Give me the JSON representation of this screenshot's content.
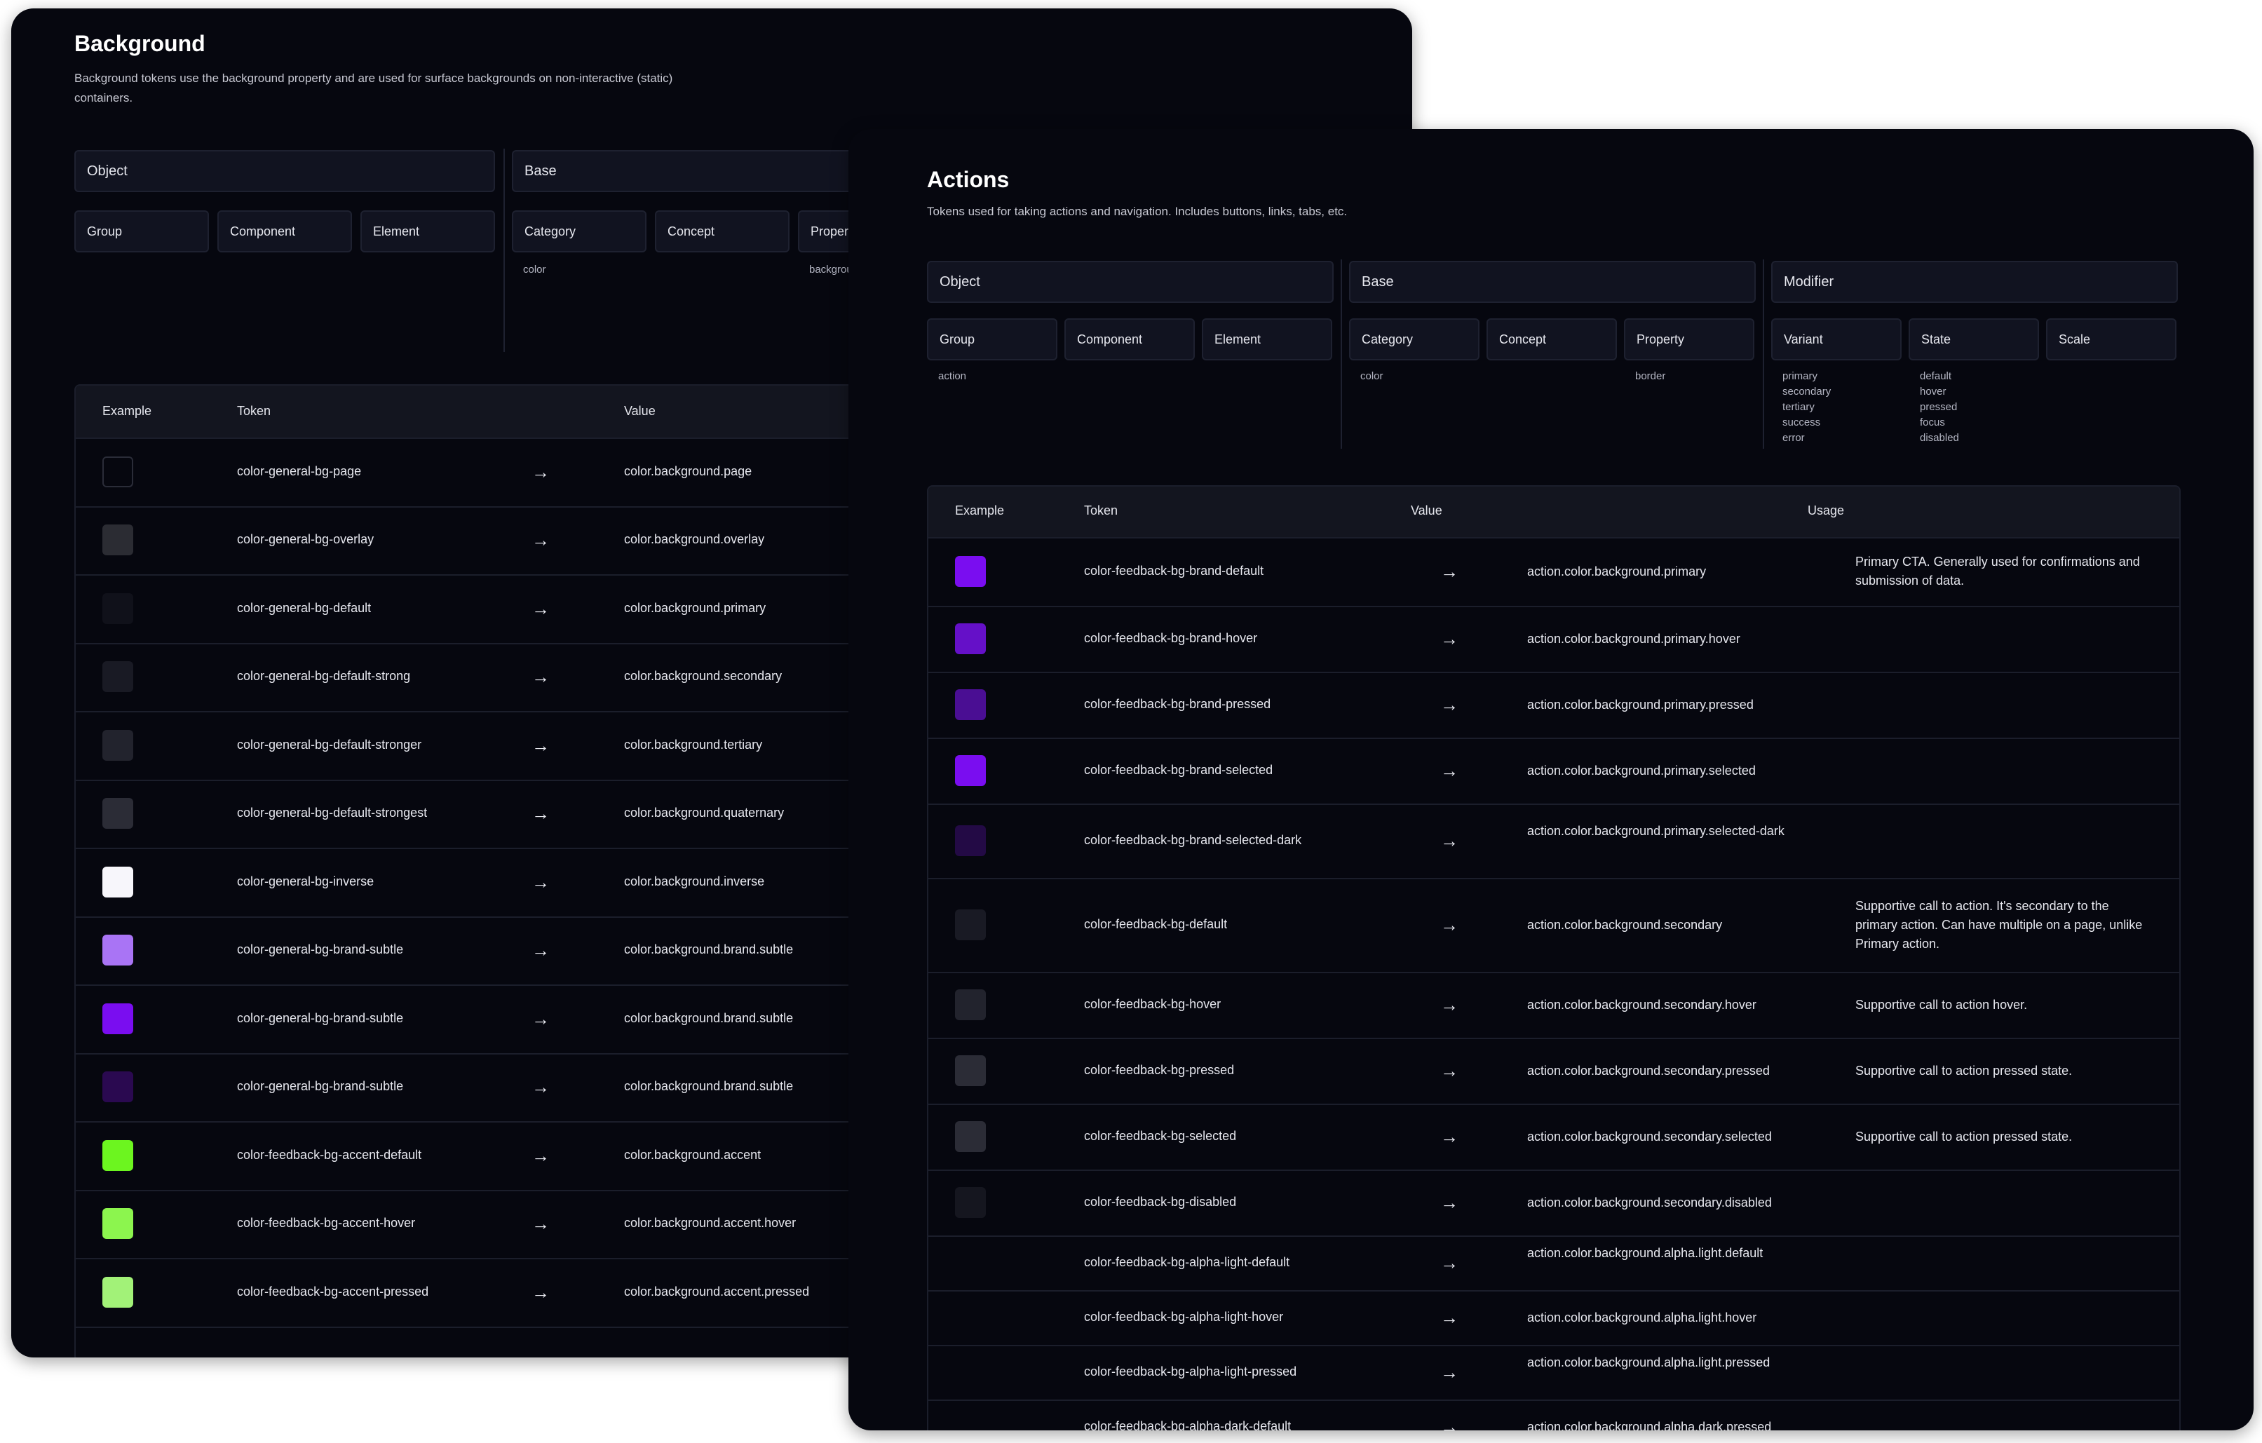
{
  "background_panel": {
    "title": "Background",
    "description": "Background tokens use the background property and are used for surface backgrounds on non-interactive (static) containers.",
    "groups": {
      "object": "Object",
      "base": "Base"
    },
    "columns": {
      "group": "Group",
      "component": "Component",
      "element": "Element",
      "category": "Category",
      "concept": "Concept",
      "property": "Property"
    },
    "values": {
      "category": "color",
      "property": "background"
    },
    "table_headers": {
      "example": "Example",
      "token": "Token",
      "value": "Value"
    },
    "arrow": "→",
    "rows": [
      {
        "token": "color-general-bg-page",
        "value": "color.background.page",
        "swatch": "#06070f"
      },
      {
        "token": "color-general-bg-overlay",
        "value": "color.background.overlay",
        "swatch": "#2b2c33"
      },
      {
        "token": "color-general-bg-default",
        "value": "color.background.primary",
        "swatch": "#10111a"
      },
      {
        "token": "color-general-bg-default-strong",
        "value": "color.background.secondary",
        "swatch": "#191a24"
      },
      {
        "token": "color-general-bg-default-stronger",
        "value": "color.background.tertiary",
        "swatch": "#22232d"
      },
      {
        "token": "color-general-bg-default-strongest",
        "value": "color.background.quaternary",
        "swatch": "#2b2c36"
      },
      {
        "token": "color-general-bg-inverse",
        "value": "color.background.inverse",
        "swatch": "#f7f6fb"
      },
      {
        "token": "color-general-bg-brand-subtle",
        "value": "color.background.brand.subtle",
        "swatch": "#a974f5"
      },
      {
        "token": "color-general-bg-brand-subtle",
        "value": "color.background.brand.subtle",
        "swatch": "#7a0df0"
      },
      {
        "token": "color-general-bg-brand-subtle",
        "value": "color.background.brand.subtle",
        "swatch": "#2a0950"
      },
      {
        "token": "color-feedback-bg-accent-default",
        "value": "color.background.accent",
        "swatch": "#6cf51f"
      },
      {
        "token": "color-feedback-bg-accent-hover",
        "value": "color.background.accent.hover",
        "swatch": "#8cf54e"
      },
      {
        "token": "color-feedback-bg-accent-pressed",
        "value": "color.background.accent.pressed",
        "swatch": "#a2f278"
      }
    ]
  },
  "actions_panel": {
    "title": "Actions",
    "description": "Tokens used for taking actions and navigation. Includes buttons, links, tabs, etc.",
    "groups": {
      "object": "Object",
      "base": "Base",
      "modifier": "Modifier"
    },
    "columns": {
      "group": "Group",
      "component": "Component",
      "element": "Element",
      "category": "Category",
      "concept": "Concept",
      "property": "Property",
      "variant": "Variant",
      "state": "State",
      "scale": "Scale"
    },
    "values": {
      "group": "action",
      "category": "color",
      "property": "border",
      "variants": [
        "primary",
        "secondary",
        "tertiary",
        "success",
        "error"
      ],
      "states": [
        "default",
        "hover",
        "pressed",
        "focus",
        "disabled"
      ]
    },
    "table_headers": {
      "example": "Example",
      "token": "Token",
      "value": "Value",
      "usage": "Usage"
    },
    "arrow": "→",
    "rows": [
      {
        "token": "color-feedback-bg-brand-default",
        "value": "action.color.background.primary",
        "usage": "Primary CTA. Generally used for confirmations and submission of data.",
        "swatch": "#7a0df0"
      },
      {
        "token": "color-feedback-bg-brand-hover",
        "value": "action.color.background.primary.hover",
        "usage": "",
        "swatch": "#6510c8"
      },
      {
        "token": "color-feedback-bg-brand-pressed",
        "value": "action.color.background.primary.pressed",
        "usage": "",
        "swatch": "#4a0e93"
      },
      {
        "token": "color-feedback-bg-brand-selected",
        "value": "action.color.background.primary.selected",
        "usage": "",
        "swatch": "#7a0df0"
      },
      {
        "token": "color-feedback-bg-brand-selected-dark",
        "value": "action.color.background.primary.selected-dark",
        "usage": "",
        "swatch": "#230a45"
      },
      {
        "token": "color-feedback-bg-default",
        "value": "action.color.background.secondary",
        "usage": "Supportive call to action. It's secondary to the primary action. Can have multiple on a page, unlike Primary action.",
        "swatch": "#191a24"
      },
      {
        "token": "color-feedback-bg-hover",
        "value": "action.color.background.secondary.hover",
        "usage": "Supportive call to action hover.",
        "swatch": "#22232d"
      },
      {
        "token": "color-feedback-bg-pressed",
        "value": "action.color.background.secondary.pressed",
        "usage": "Supportive call to action pressed state.",
        "swatch": "#2b2c36"
      },
      {
        "token": "color-feedback-bg-selected",
        "value": "action.color.background.secondary.selected",
        "usage": "Supportive call to action pressed state.",
        "swatch": "#2b2c36"
      },
      {
        "token": "color-feedback-bg-disabled",
        "value": "action.color.background.secondary.disabled",
        "usage": "",
        "swatch": "#15161f"
      },
      {
        "token": "color-feedback-bg-alpha-light-default",
        "value": "action.color.background.alpha.light.default",
        "usage": "",
        "swatch": ""
      },
      {
        "token": "color-feedback-bg-alpha-light-hover",
        "value": "action.color.background.alpha.light.hover",
        "usage": "",
        "swatch": ""
      },
      {
        "token": "color-feedback-bg-alpha-light-pressed",
        "value": "action.color.background.alpha.light.pressed",
        "usage": "",
        "swatch": ""
      },
      {
        "token": "color-feedback-bg-alpha-dark-default",
        "value": "action.color.background.alpha.dark.pressed",
        "usage": "",
        "swatch": ""
      }
    ]
  }
}
